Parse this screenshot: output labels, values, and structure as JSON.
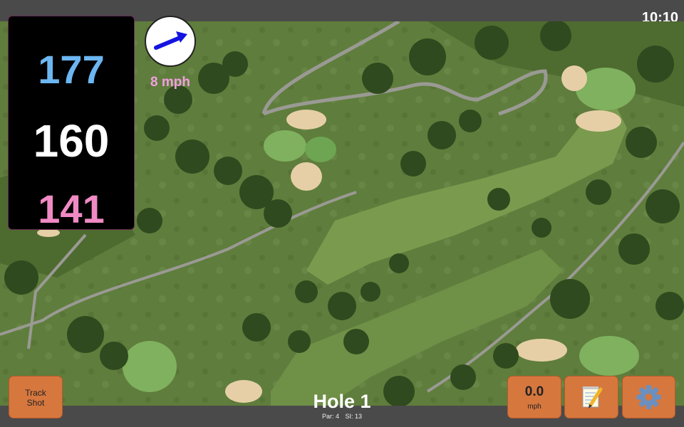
{
  "status": {
    "time": "10:10"
  },
  "distances": {
    "back": "177",
    "center": "160",
    "front": "141"
  },
  "wind": {
    "speed_label": "8 mph",
    "arrow_icon": "arrow-right-icon",
    "arrow_color": "#1414e0"
  },
  "hole": {
    "title": "Hole 1",
    "par": "Par: 4",
    "si": "SI: 13"
  },
  "buttons": {
    "track_shot_line1": "Track",
    "track_shot_line2": "Shot",
    "wind_value": "0.0",
    "wind_unit": "mph",
    "notes_icon": "notepad-pencil-icon",
    "settings_icon": "gear-icon"
  },
  "colors": {
    "back": "#6cb6f2",
    "center": "#ffffff",
    "front": "#f08ac4",
    "button": "#d6773e",
    "wind_text": "#f29fe0"
  }
}
